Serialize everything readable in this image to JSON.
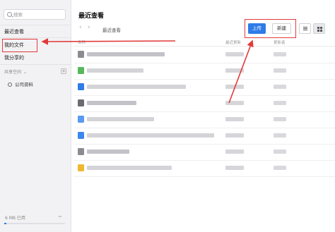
{
  "sidebar": {
    "search_placeholder": "搜索",
    "items": [
      {
        "label": "最近查看",
        "active": true
      },
      {
        "label": "我的文件",
        "active": false
      },
      {
        "label": "我分享的",
        "active": false
      }
    ],
    "section_label": "共享空间",
    "team_space": "公司资料",
    "storage_used": "6 MB 已用",
    "storage_fraction": 0.04,
    "more_label": "···"
  },
  "main": {
    "title": "最近查看",
    "back_icon": "chevron-left-icon",
    "forward_icon": "chevron-right-icon",
    "breadcrumb": "最近查看",
    "upload_label": "上传",
    "new_label": "新建",
    "columns": [
      "名称",
      "最近更新",
      "更新者"
    ],
    "rows": [
      {
        "icon_color": "#8b8b93",
        "name": "",
        "date": "",
        "user": ""
      },
      {
        "icon_color": "#57b85a",
        "name": "",
        "date": "",
        "user": ""
      },
      {
        "icon_color": "#2f7be8",
        "name": "",
        "date": "",
        "user": ""
      },
      {
        "icon_color": "#6b6b73",
        "name": "",
        "date": "",
        "user": ""
      },
      {
        "icon_color": "#5a9af0",
        "name": "",
        "date": "",
        "user": ""
      },
      {
        "icon_color": "#3b87ee",
        "name": "",
        "date": "",
        "user": ""
      },
      {
        "icon_color": "#8b8b93",
        "name": "",
        "date": "",
        "user": ""
      },
      {
        "icon_color": "#f0b830",
        "name": "",
        "date": "",
        "user": ""
      }
    ]
  },
  "colors": {
    "accent": "#2f7be8",
    "annotation": "#e23a3a",
    "sidebar_bg": "#f2f2f4"
  }
}
